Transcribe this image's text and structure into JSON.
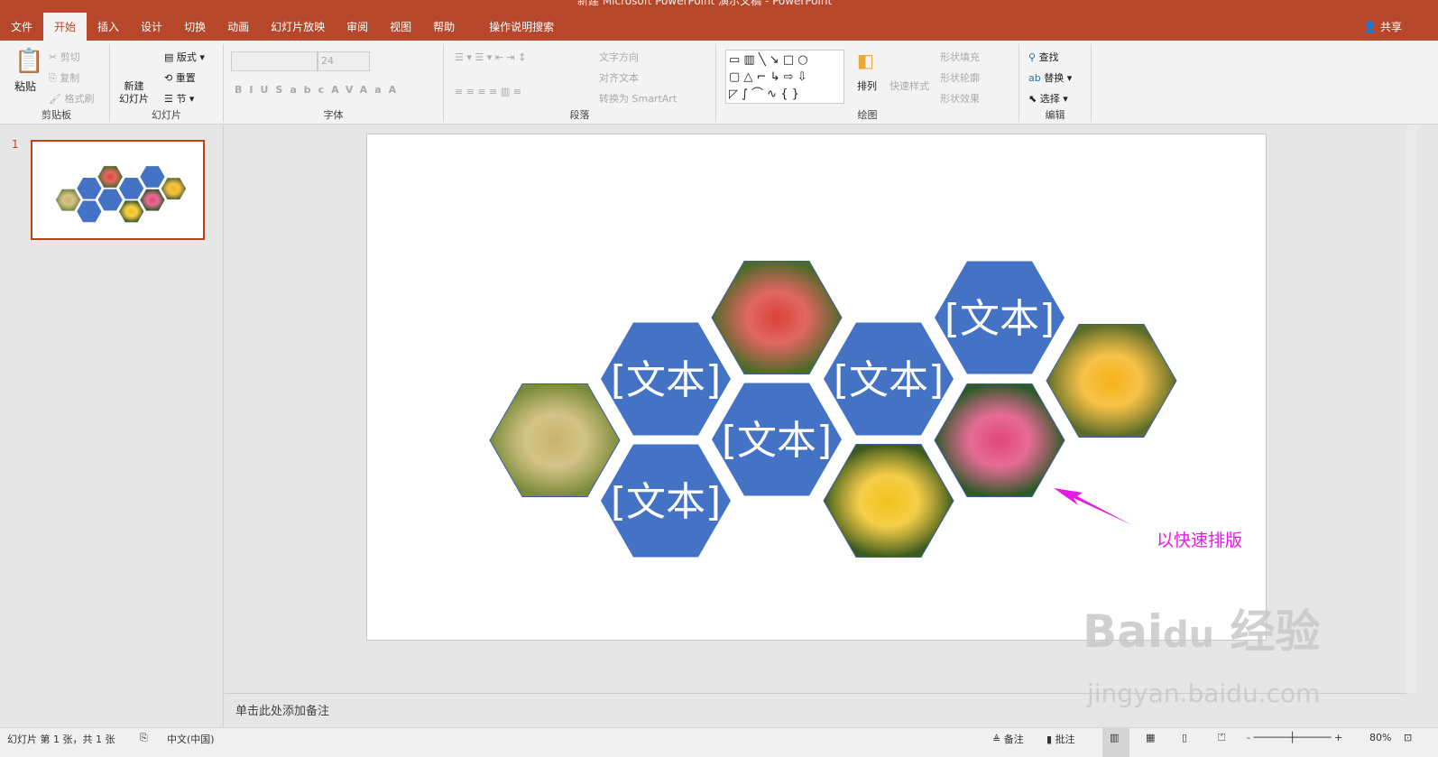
{
  "window": {
    "title": "新建 Microsoft PowerPoint 演示文稿 - PowerPoint",
    "share": "共享"
  },
  "tabs": [
    "文件",
    "开始",
    "插入",
    "设计",
    "切换",
    "动画",
    "幻灯片放映",
    "审阅",
    "视图",
    "帮助",
    "操作说明搜索"
  ],
  "ribbon": {
    "clipboard": {
      "label": "剪贴板",
      "paste": "粘贴",
      "cut": "剪切",
      "copy": "复制",
      "format_painter": "格式刷"
    },
    "slides": {
      "label": "幻灯片",
      "new_slide": "新建\n幻灯片",
      "layout": "版式",
      "reset": "重置",
      "section": "节"
    },
    "font": {
      "label": "字体",
      "font_name": "",
      "font_size": "24"
    },
    "paragraph": {
      "label": "段落",
      "text_direction": "文字方向",
      "align_text": "对齐文本",
      "smartart": "转换为 SmartArt"
    },
    "drawing": {
      "label": "绘图",
      "arrange": "排列",
      "quick_styles": "快速样式",
      "shape_fill": "形状填充",
      "shape_outline": "形状轮廓",
      "shape_effects": "形状效果"
    },
    "editing": {
      "label": "编辑",
      "find": "查找",
      "replace": "替换",
      "select": "选择"
    }
  },
  "slide_panel": {
    "number": "1"
  },
  "slide": {
    "placeholder": "[文本]",
    "annotation": "以快速排版",
    "hex_color": "#4472c4",
    "annotation_color": "#e619e6"
  },
  "notes": {
    "placeholder": "单击此处添加备注"
  },
  "status": {
    "slide_info": "幻灯片 第 1 张，共 1 张",
    "language": "中文(中国)",
    "notes": "备注",
    "comments": "批注",
    "zoom": "80%"
  },
  "watermark": {
    "logo": "Bai du 经验",
    "url": "jingyan.baidu.com"
  }
}
